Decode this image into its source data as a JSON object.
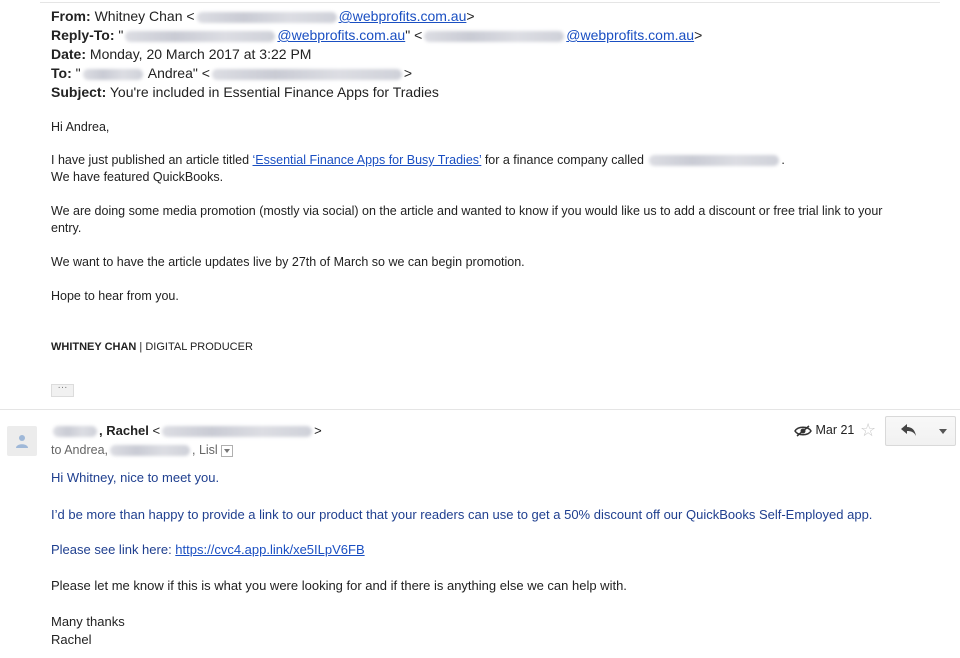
{
  "original_header": {
    "from_label": "From:",
    "from_name": "Whitney Chan <",
    "from_domain": "@webprofits.com.au",
    "from_close": ">",
    "replyto_label": "Reply-To:",
    "replyto_open": "\"",
    "replyto_domain": "@webprofits.com.au",
    "replyto_mid": "\" <",
    "replyto_domain2": "@webprofits.com.au",
    "replyto_close": ">",
    "date_label": "Date:",
    "date_value": "Monday, 20 March 2017 at 3:22 PM",
    "to_label": "To:",
    "to_open": "\"",
    "to_name": " Andrea\" <",
    "to_close": ">",
    "subject_label": "Subject:",
    "subject_value": "You're included in Essential Finance Apps for Tradies"
  },
  "original_body": {
    "greeting": "Hi Andrea,",
    "line1_before": "I have just published an article titled ",
    "line1_link": "‘Essential Finance Apps for Busy Tradies’",
    "line1_after": " for a finance company called ",
    "line1_end": ".",
    "line2": "We have featured QuickBooks.",
    "para2_line1": "We are doing some media promotion (mostly via social) on the article and wanted to know if you would like us to add a discount or free trial link to your",
    "para2_line2": "entry.",
    "para3": "We want to have the article updates live by 27th of March so we can begin promotion.",
    "para4": "Hope to hear from you.",
    "sig_name": "WHITNEY CHAN",
    "sig_sep": " | ",
    "sig_title": "DIGITAL PRODUCER",
    "dots": "···"
  },
  "reply_header": {
    "sender_name": ", Rachel",
    "sender_open": " <",
    "sender_close": ">",
    "to_prefix": "to Andrea,",
    "to_suffix": ", Lisl",
    "date": "Mar 21",
    "star_icon": "☆"
  },
  "reply_body": {
    "greeting": "Hi Whitney, nice to meet you.",
    "para1": "I’d be more than happy to provide a link to our product that your readers can use to get a 50% discount off our QuickBooks Self-Employed app.",
    "para2_before": "Please see link here: ",
    "para2_link": "https://cvc4.app.link/xe5ILpV6FB",
    "para3": "Please let me know if this is what you were looking for and if there is anything else we can help with.",
    "closing1": "Many thanks",
    "closing2": "Rachel"
  }
}
